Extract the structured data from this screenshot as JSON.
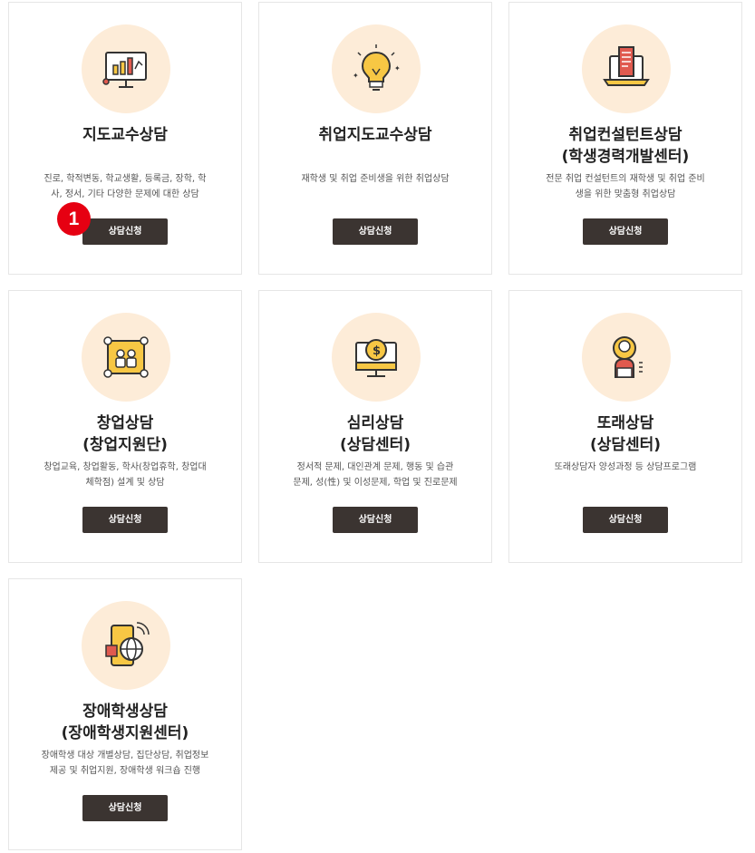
{
  "button_label": "상담신청",
  "badge": "1",
  "colors": {
    "icon_bg": "#fdecd8",
    "button_bg": "#3b3431",
    "badge": "#e60012",
    "accent_yellow": "#f7c744",
    "accent_red": "#e05a4f"
  },
  "cards": [
    {
      "icon": "presentation-chart-icon",
      "title": [
        "지도교수상담"
      ],
      "desc": [
        "진로, 학적변동, 학교생활, 등록금, 장학, 학",
        "사, 정서, 기타 다양한 문제에 대한 상담"
      ]
    },
    {
      "icon": "lightbulb-icon",
      "title": [
        "취업지도교수상담"
      ],
      "desc": [
        "재학생 및 취업 준비생을 위한 취업상담"
      ]
    },
    {
      "icon": "laptop-document-icon",
      "title": [
        "취업컨설턴트상담",
        "(학생경력개발센터)"
      ],
      "desc": [
        "전문 취업 컨설턴트의 재학생 및 취업 준비",
        "생을 위한 맞춤형 취업상담"
      ]
    },
    {
      "icon": "team-board-icon",
      "title": [
        "창업상담",
        "(창업지원단)"
      ],
      "desc": [
        "창업교육, 창업활동, 학사(창업휴학, 창업대",
        "체학점) 설계 및 상담"
      ]
    },
    {
      "icon": "monitor-dollar-icon",
      "title": [
        "심리상담",
        "(상담센터)"
      ],
      "desc": [
        "정서적 문제, 대인관계 문제, 행동 및 습관",
        "문제, 성(性) 및 이성문제, 학업 및 진로문제"
      ]
    },
    {
      "icon": "person-counselor-icon",
      "title": [
        "또래상담",
        "(상담센터)"
      ],
      "desc": [
        "또래상담자 양성과정 등 상담프로그램"
      ]
    },
    {
      "icon": "phone-globe-icon",
      "title": [
        "장애학생상담",
        "(장애학생지원센터)"
      ],
      "desc": [
        "장애학생 대상 개별상담, 집단상담, 취업정보",
        "제공 및 취업지원, 장애학생 워크숍 진행"
      ]
    }
  ]
}
